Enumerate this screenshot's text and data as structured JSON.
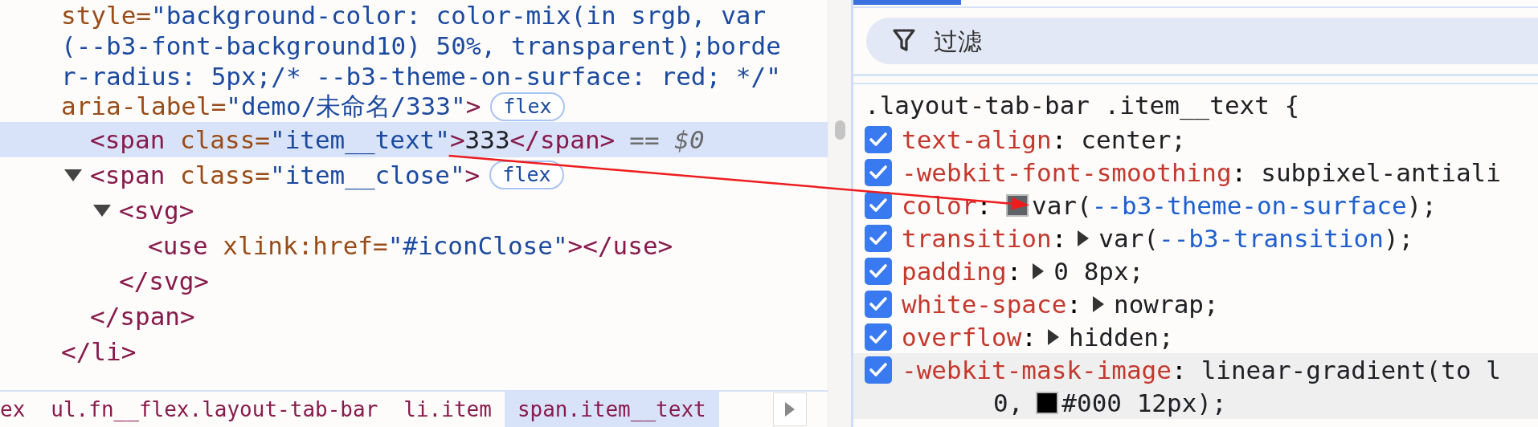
{
  "elements_panel": {
    "nodes": [
      {
        "selected": false,
        "badge": "flex",
        "open_lines": [
          [
            {
              "t": "style=",
              "kind": "attr"
            },
            {
              "t": "\"background-color: color-mix(in srgb, var",
              "kind": "value"
            }
          ],
          [
            {
              "t": "(--b3-font-background10) 50%, transparent);borde",
              "kind": "value"
            }
          ],
          [
            {
              "t": "r-radius: 5px;/* --b3-theme-on-surface: red; */\"",
              "kind": "value"
            }
          ],
          [
            {
              "t": "aria-label=",
              "kind": "attr"
            },
            {
              "t": "\"demo/未命名/333\"",
              "kind": "value"
            },
            {
              "t": ">",
              "kind": "tag"
            }
          ]
        ],
        "children": [
          {
            "selected": true,
            "marker": "== $0",
            "open_lines": [
              [
                {
                  "t": "<span ",
                  "kind": "tag"
                },
                {
                  "t": "class=",
                  "kind": "attr"
                },
                {
                  "t": "\"item__text\"",
                  "kind": "value"
                },
                {
                  "t": ">",
                  "kind": "tag"
                },
                {
                  "t": "333",
                  "kind": "text"
                },
                {
                  "t": "</span>",
                  "kind": "tag"
                }
              ]
            ]
          },
          {
            "selected": false,
            "expanded": true,
            "badge": "flex",
            "open_lines": [
              [
                {
                  "t": "<span ",
                  "kind": "tag"
                },
                {
                  "t": "class=",
                  "kind": "attr"
                },
                {
                  "t": "\"item__close\"",
                  "kind": "value"
                },
                {
                  "t": ">",
                  "kind": "tag"
                }
              ]
            ],
            "children": [
              {
                "selected": false,
                "expanded": true,
                "open_lines": [
                  [
                    {
                      "t": "<svg>",
                      "kind": "tag"
                    }
                  ]
                ],
                "children": [
                  {
                    "selected": false,
                    "open_lines": [
                      [
                        {
                          "t": "<use ",
                          "kind": "tag"
                        },
                        {
                          "t": "xlink:href=",
                          "kind": "attr"
                        },
                        {
                          "t": "\"#iconClose\"",
                          "kind": "value"
                        },
                        {
                          "t": "></use>",
                          "kind": "tag"
                        }
                      ]
                    ]
                  }
                ],
                "close": [
                  {
                    "t": "</svg>",
                    "kind": "tag"
                  }
                ]
              }
            ],
            "close": [
              {
                "t": "</span>",
                "kind": "tag"
              }
            ]
          }
        ],
        "close": [
          {
            "t": "</li>",
            "kind": "tag"
          }
        ]
      }
    ],
    "breadcrumbs": [
      {
        "label": "ex",
        "selected": false
      },
      {
        "label": "ul.fn__flex.layout-tab-bar",
        "selected": false
      },
      {
        "label": "li.item",
        "selected": false
      },
      {
        "label": "span.item__text",
        "selected": true
      }
    ]
  },
  "styles_panel": {
    "filter": {
      "placeholder": "过滤"
    },
    "rule": {
      "selector": ".layout-tab-bar .item__text {",
      "properties": [
        {
          "name": "text-align",
          "separator": ":",
          "checked": true,
          "expandable": false,
          "hovered": false,
          "value_lines": [
            [
              {
                "t": "center;",
                "kind": "plain"
              }
            ]
          ]
        },
        {
          "name": "-webkit-font-smoothing",
          "separator": ":",
          "checked": true,
          "expandable": false,
          "hovered": false,
          "value_lines": [
            [
              {
                "t": "subpixel-antiali",
                "kind": "plain"
              }
            ]
          ]
        },
        {
          "name": "color",
          "separator": ":",
          "checked": true,
          "expandable": false,
          "hovered": false,
          "value_lines": [
            [
              {
                "kind": "swatch",
                "color": "#5f6368"
              },
              {
                "t": "var(",
                "kind": "plain"
              },
              {
                "t": "--b3-theme-on-surface",
                "kind": "variable"
              },
              {
                "t": ");",
                "kind": "plain"
              }
            ]
          ]
        },
        {
          "name": "transition",
          "separator": ":",
          "checked": true,
          "expandable": true,
          "hovered": false,
          "value_lines": [
            [
              {
                "t": "var(",
                "kind": "plain"
              },
              {
                "t": "--b3-transition",
                "kind": "variable"
              },
              {
                "t": ");",
                "kind": "plain"
              }
            ]
          ]
        },
        {
          "name": "padding",
          "separator": ":",
          "checked": true,
          "expandable": true,
          "hovered": false,
          "value_lines": [
            [
              {
                "t": "0 8px;",
                "kind": "plain"
              }
            ]
          ]
        },
        {
          "name": "white-space",
          "separator": ":",
          "checked": true,
          "expandable": true,
          "hovered": false,
          "value_lines": [
            [
              {
                "t": "nowrap;",
                "kind": "plain"
              }
            ]
          ]
        },
        {
          "name": "overflow",
          "separator": ":",
          "checked": true,
          "expandable": true,
          "hovered": false,
          "value_lines": [
            [
              {
                "t": "hidden;",
                "kind": "plain"
              }
            ]
          ]
        },
        {
          "name": "-webkit-mask-image",
          "separator": ":",
          "checked": true,
          "expandable": false,
          "hovered": true,
          "value_lines": [
            [
              {
                "t": "linear-gradient(to l",
                "kind": "plain"
              }
            ],
            [
              {
                "t": "0,",
                "kind": "plain"
              },
              {
                "kind": "swatch",
                "color": "#000000"
              },
              {
                "t": "#000 12px);",
                "kind": "plain"
              }
            ]
          ]
        }
      ]
    }
  }
}
